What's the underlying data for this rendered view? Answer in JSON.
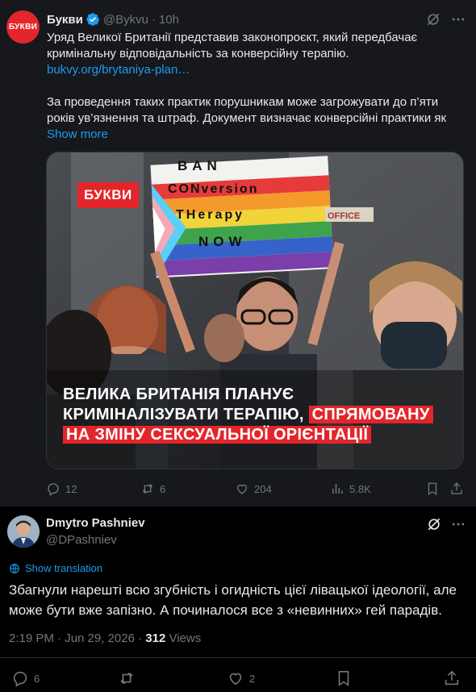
{
  "quoted": {
    "avatar_text": "БУКВИ",
    "name": "Букви",
    "handle": "@Bykvu",
    "separator": "·",
    "time": "10h",
    "text_line1": "Уряд Великої Британії представив законопроєкт, який передбачає кримінальну відповідальність за конверсійну терапію.",
    "link": "bukvy.org/brytaniya-plan…",
    "text_para2": "За проведення таких практик порушникам може загрожувати до п’яти років ув’язнення та штраф. Документ визначає конверсійні практики як",
    "show_more": "Show more",
    "media": {
      "badge": "БУКВИ",
      "sign_lines": [
        "BAN",
        "CONversion",
        "THerapy",
        "NOW"
      ],
      "sign_office": "OFFICE",
      "headline_white": "ВЕЛИКА БРИТАНІЯ ПЛАНУЄ КРИМІНАЛІЗУВАТИ ТЕРАПІЮ,",
      "headline_red": "СПРЯМОВАНУ НА ЗМІНУ СЕКСУАЛЬНОЇ ОРІЄНТАЦІЇ"
    },
    "actions": {
      "replies": "12",
      "reposts": "6",
      "likes": "204",
      "views": "5.8K"
    }
  },
  "reply": {
    "name": "Dmytro Pashniev",
    "handle": "@DPashniev",
    "show_translation": "Show translation",
    "text": "Збагнули нарешті всю згубність і огидність цієї лівацької ідеології, але може бути вже запізно. А починалося все з «невинних» гей парадів.",
    "time": "2:19 PM · Jun 29, 2026 ·",
    "views_count": "312",
    "views_label": "Views",
    "actions": {
      "replies": "6",
      "likes": "2"
    }
  },
  "colors": {
    "accent": "#1d9bf0",
    "brand_red": "#e3262b",
    "muted": "#71767b",
    "bg": "#000000",
    "quoted_bg": "#16181c"
  },
  "icons": [
    "verified-badge-icon",
    "grok-icon",
    "more-icon",
    "reply-icon",
    "repost-icon",
    "like-icon",
    "views-icon",
    "bookmark-icon",
    "share-icon",
    "translate-icon"
  ]
}
